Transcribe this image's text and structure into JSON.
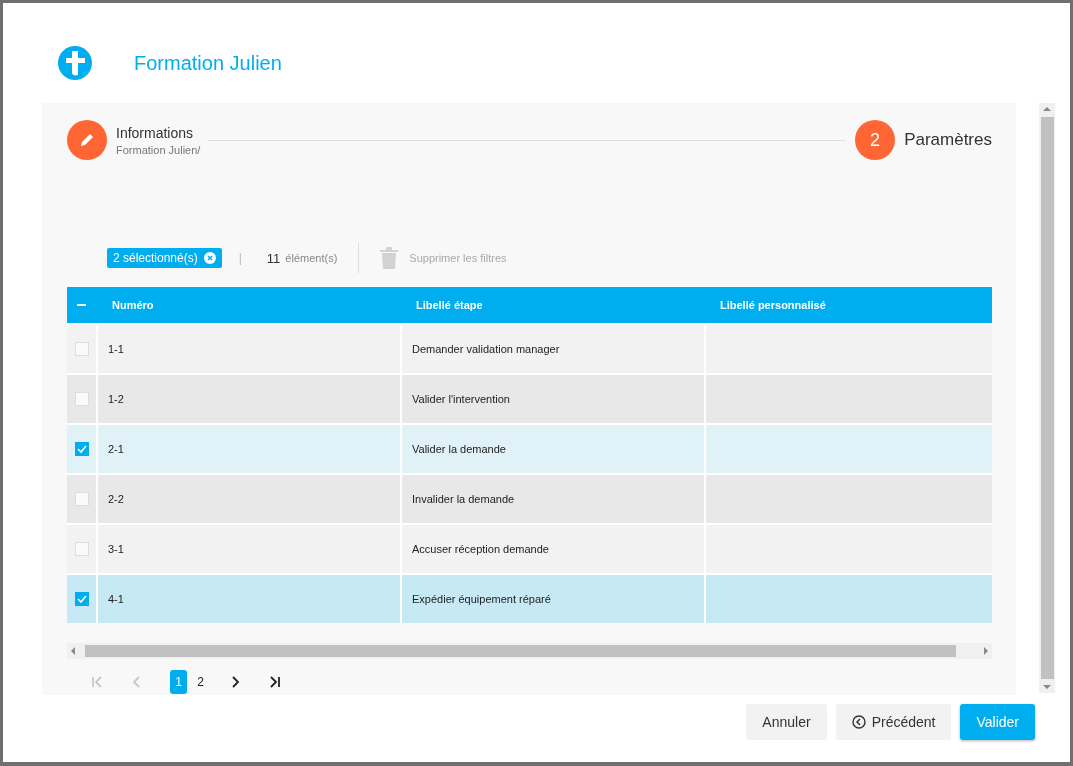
{
  "dialog": {
    "title": "Formation Julien"
  },
  "steps": [
    {
      "kind": "icon",
      "title": "Informations",
      "subtitle": "Formation Julien/"
    },
    {
      "kind": "number",
      "number": "2",
      "title": "Paramètres"
    }
  ],
  "toolbar": {
    "selection_chip": "2 sélectionné(s)",
    "separator": "|",
    "count": "11",
    "count_label": "élément(s)",
    "clear_filters": {
      "label": "Supprimer les filtres",
      "disabled": true
    }
  },
  "table": {
    "header_checkbox": {
      "indeterminate": true
    },
    "columns": [
      "Numéro",
      "Libellé étape",
      "Libellé personnalisé"
    ],
    "rows": [
      {
        "numero": "1-1",
        "libelle": "Demander validation manager",
        "personnalise": "",
        "checked": false
      },
      {
        "numero": "1-2",
        "libelle": "Valider l'intervention",
        "personnalise": "",
        "checked": false
      },
      {
        "numero": "2-1",
        "libelle": "Valider la demande",
        "personnalise": "",
        "checked": true
      },
      {
        "numero": "2-2",
        "libelle": "Invalider la demande",
        "personnalise": "",
        "checked": false
      },
      {
        "numero": "3-1",
        "libelle": "Accuser réception demande",
        "personnalise": "",
        "checked": false
      },
      {
        "numero": "4-1",
        "libelle": "Expédier équipement réparé",
        "personnalise": "",
        "checked": true
      }
    ]
  },
  "pagination": {
    "nav": [
      {
        "kind": "first",
        "disabled": true
      },
      {
        "kind": "prev",
        "disabled": true
      }
    ],
    "pages": [
      {
        "label": "1",
        "selected": true
      },
      {
        "label": "2",
        "selected": false
      }
    ],
    "nav_after": [
      {
        "kind": "next",
        "disabled": false
      },
      {
        "kind": "last",
        "disabled": false
      }
    ]
  },
  "buttons": [
    {
      "kind": "cancel",
      "label": "Annuler"
    },
    {
      "kind": "back",
      "label": "Précédent"
    },
    {
      "kind": "primary",
      "label": "Valider"
    }
  ]
}
